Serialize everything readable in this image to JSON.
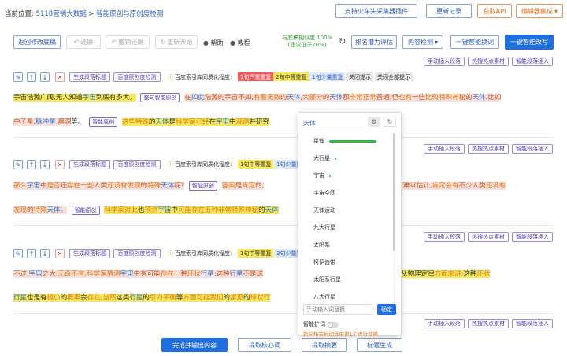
{
  "header": {
    "location_prefix": "当前位置:",
    "crumb1": "5118营销大数据",
    "crumb_sep": ">",
    "crumb2": "智能原创与原创度检测",
    "btn_plugin": "支持火车头采集器插件",
    "btn_update": "更新记录",
    "btn_api": "获取API",
    "btn_editor": "编辑器集成"
  },
  "toolbar": {
    "back": "返回修改底稿",
    "undo": "还原",
    "undo_smart": "撤销还原",
    "restart": "重新开始",
    "help": "帮助",
    "tutorial": "教程",
    "similarity_label": "与底稿相似度 100%",
    "similarity_sub": "(建议低于70%)",
    "potential": "排名潜力评估",
    "detect": "内容检测",
    "replace": "一键智能换词",
    "rewrite": "一键智能改写"
  },
  "row_buttons": {
    "insert": "手动插入段落",
    "hot": "热搜热点素材",
    "smart_insert": "智能段落插入"
  },
  "para_tools": {
    "gen_title": "生成段落标题",
    "check": "百度原创度检测",
    "index_label": "百度索引库同质化程度:",
    "severe": "1句严重重复",
    "medium": "1句中等重复",
    "medium2": "2句中等重复",
    "few": "1句少量重复",
    "few3": "3句少量重复",
    "close_hint": "关闭提示",
    "close_all": "关闭全部提示",
    "smart_orig": "智能原创",
    "para_smart_orig": "整句智能原创"
  },
  "para1": {
    "line1": [
      "宇宙浩瀚广阔,",
      "无人知道",
      "宇宙",
      "到底",
      "有多大。",
      "在",
      "如此",
      "浩瀚的宇宙",
      "不如,",
      "有着",
      "无数",
      "的",
      "天体",
      ",",
      "大部分",
      "的",
      "天体",
      "都",
      "非常",
      "正常",
      "普通",
      ",",
      "但",
      "也有",
      "一些",
      "比较",
      "特殊",
      "神秘",
      "的",
      "天体",
      ",",
      "比如"
    ],
    "line2": [
      "中子星",
      ",",
      "脉冲星",
      ",",
      "黑洞",
      "等。",
      "这些",
      "特殊",
      "的",
      "天体",
      "是",
      "科学家",
      "已经",
      "在",
      "宇宙",
      "中",
      "观测",
      "并研究"
    ]
  },
  "para2": {
    "line1": [
      "那么",
      "宇宙",
      "中",
      "是否",
      "还",
      "存在",
      "一些",
      "人类",
      "还没有",
      "发现",
      "的",
      "特殊",
      "天体",
      "呢?",
      "答案",
      "是",
      "肯定",
      "的,",
      "天体",
      "数量",
      "更是",
      "难以估计,",
      "肯定",
      "会",
      "有",
      "不少",
      "人类",
      "还没有"
    ],
    "line2": [
      "发现",
      "的",
      "特殊",
      "天体。",
      "科学家",
      "对此",
      "也",
      "预测",
      "宇宙",
      "中",
      "可能",
      "存在",
      "五种",
      "非常",
      "特殊",
      "神秘",
      "的",
      "天体"
    ]
  },
  "para3": {
    "line1": [
      "不过,",
      "宇宙",
      "之大,",
      "无奇不有,",
      "科学家",
      "猜测",
      "宇宙",
      "中",
      "有可能",
      "存在",
      "一种",
      "环状",
      "行星,",
      "这种",
      "行星",
      "不是",
      "球",
      "从物理定律",
      "方面",
      "来讲,",
      "这种",
      "环状"
    ],
    "line2": [
      "行星",
      "也是",
      "有",
      "极小",
      "的",
      "概率",
      "会",
      "存在,",
      "当然",
      "这类",
      "行星",
      "的",
      "引力",
      "平衡",
      "等",
      "方面",
      "可能",
      "我们",
      "的",
      "常见",
      "的",
      "球状",
      "行"
    ]
  },
  "popup": {
    "title": "天体",
    "search_placeholder": "手动输入词替换",
    "confirm": "确定",
    "expand_label": "智能扩词",
    "hint": "按空格会自动选中第1个进行替换",
    "options": [
      "星体",
      "大行星",
      "宇宙",
      "宇宙空间",
      "天体运动",
      "九大行星",
      "太阳系",
      "柯伊伯带",
      "太阳系行星",
      "八大行星"
    ],
    "bars": [
      1.0,
      0.04,
      0.03,
      0,
      0,
      0,
      0,
      0,
      0,
      0
    ]
  },
  "footer": {
    "finish": "完成并输出内容",
    "keywords": "提取核心词",
    "summary": "提取摘要",
    "title_gen": "标题生成"
  },
  "icons": {
    "edit": "✎",
    "up": "↑",
    "down": "↓",
    "close": "✕",
    "undo": "↶",
    "refresh": "↻",
    "gear": "⚙",
    "help": "●",
    "caret": "▾"
  }
}
